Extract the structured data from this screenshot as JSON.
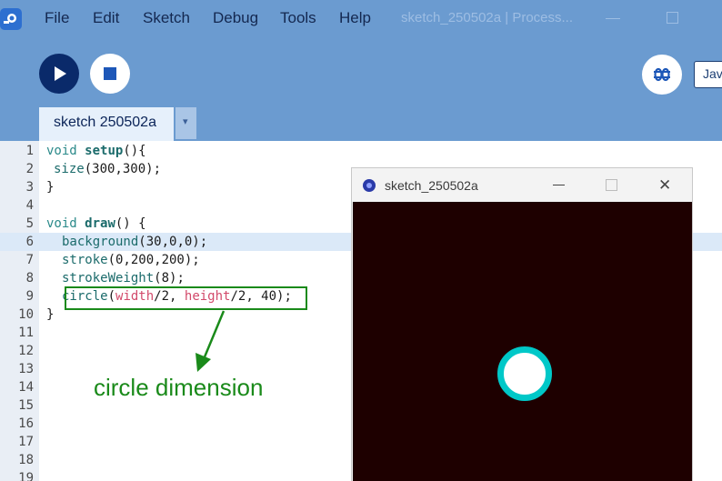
{
  "menu": {
    "items": [
      "File",
      "Edit",
      "Sketch",
      "Debug",
      "Tools",
      "Help"
    ]
  },
  "window": {
    "title": "sketch_250502a | Process..."
  },
  "toolbar": {
    "run_icon": "play-icon",
    "stop_icon": "stop-icon",
    "debug_icon": "debugger-icon",
    "mode_label": "Jav"
  },
  "tab": {
    "label": "sketch 250502a",
    "menu_icon": "▾"
  },
  "editor": {
    "line_numbers": [
      "1",
      "2",
      "3",
      "4",
      "5",
      "6",
      "7",
      "8",
      "9",
      "10",
      "11",
      "12",
      "13",
      "14",
      "15",
      "16",
      "17",
      "18",
      "19"
    ],
    "highlighted_line": "6",
    "code": {
      "l1_kw": "void",
      "l1_fn": "setup",
      "l1_rest": "(){",
      "l2_fn": "size",
      "l2_rest": "(300,300);",
      "l3": "}",
      "l5_kw": "void",
      "l5_fn": "draw",
      "l5_rest": "() {",
      "l6_fn": "background",
      "l6_rest": "(30,0,0);",
      "l7_fn": "stroke",
      "l7_rest": "(0,200,200);",
      "l8_fn": "strokeWeight",
      "l8_rest": "(8);",
      "l9_fn": "circle",
      "l9_p1": "(",
      "l9_v1": "width",
      "l9_p2": "/2, ",
      "l9_v2": "height",
      "l9_p3": "/2, 40);",
      "l10": "}"
    }
  },
  "annotation": {
    "label": "circle dimension",
    "color": "#1a8a1a"
  },
  "sketch_window": {
    "title": "sketch_250502a",
    "min_icon": "minimize-icon",
    "max_icon": "maximize-icon",
    "close_label": "✕",
    "background_color": "#1e0000",
    "circle_stroke": "#00c8c8",
    "circle_fill": "#ffffff"
  },
  "colors": {
    "header_bg": "#6b9bd0",
    "run_button": "#0a2a6a",
    "stop_square": "#1d57b8"
  }
}
